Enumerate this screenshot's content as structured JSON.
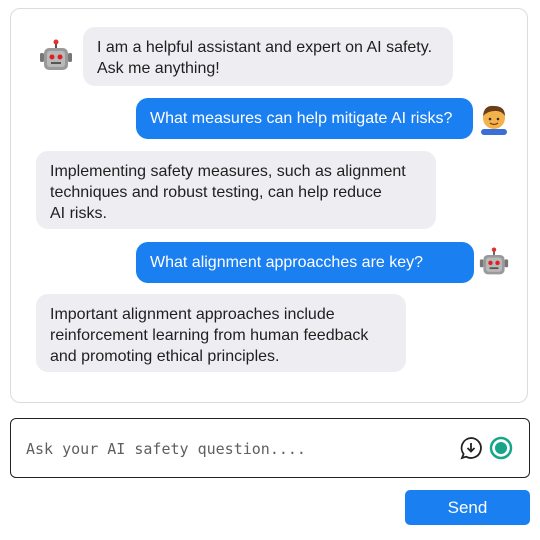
{
  "messages": [
    {
      "role": "bot",
      "text": "I am a helpful assistant and expert on AI safety.\nAsk me anything!",
      "avatar": "robot-icon"
    },
    {
      "role": "user",
      "text": "What measures can help mitigate AI risks?",
      "avatar": "user-face-icon"
    },
    {
      "role": "bot",
      "text": "Implementing safety measures, such as alignment\ntechniques and robust testing, can help reduce\nAI risks."
    },
    {
      "role": "user",
      "text": "What alignment approacches are key?",
      "avatar": "robot-icon"
    },
    {
      "role": "bot",
      "text": "Important alignment approaches include\nreinforcement learning from human feedback\nand promoting ethical principles."
    }
  ],
  "input": {
    "placeholder": "Ask your AI safety question....",
    "value": "",
    "icons": [
      "download-icon",
      "record-icon"
    ]
  },
  "send_button": {
    "label": "Send"
  },
  "colors": {
    "accent": "#1a7ff0",
    "bot_bubble": "#eeeef2",
    "record": "#17a589"
  }
}
